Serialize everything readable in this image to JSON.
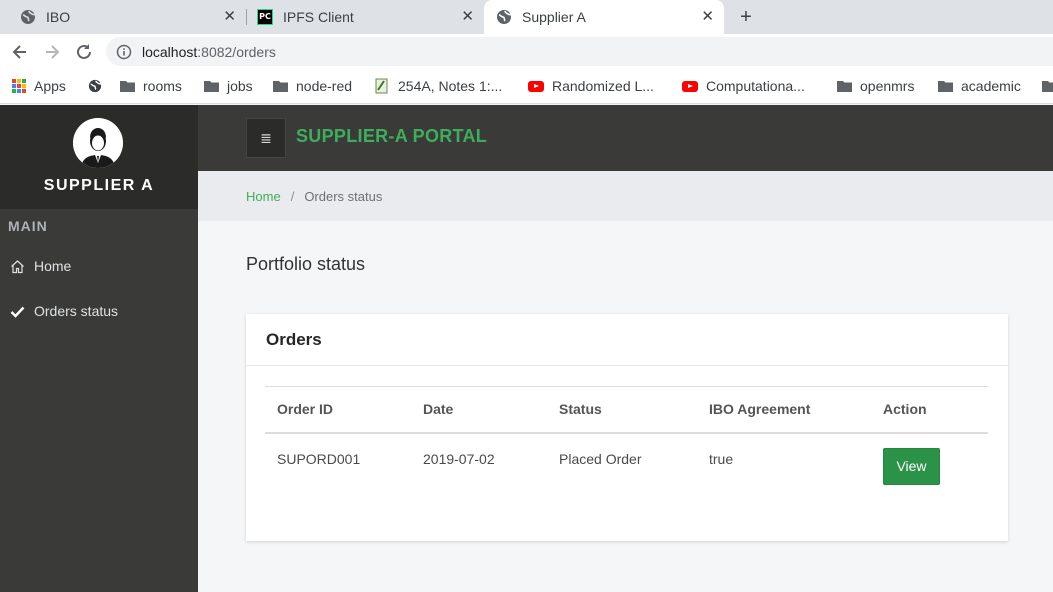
{
  "browser": {
    "tabs": [
      {
        "title": "IBO",
        "icon": "globe-icon",
        "active": false
      },
      {
        "title": "IPFS Client",
        "icon": "pycharm-icon",
        "active": false
      },
      {
        "title": "Supplier A",
        "icon": "globe-icon",
        "active": true
      }
    ],
    "url_host": "localhost",
    "url_rest": ":8082/orders",
    "bookmarks": [
      {
        "label": "Apps",
        "icon": "apps-grid-icon"
      },
      {
        "label": "",
        "icon": "globe-icon"
      },
      {
        "label": "rooms",
        "icon": "folder-icon"
      },
      {
        "label": "jobs",
        "icon": "folder-icon"
      },
      {
        "label": "node-red",
        "icon": "folder-icon"
      },
      {
        "label": "254A, Notes 1:...",
        "icon": "page-icon"
      },
      {
        "label": "Randomized L...",
        "icon": "youtube-icon"
      },
      {
        "label": "Computationa...",
        "icon": "youtube-icon"
      },
      {
        "label": "openmrs",
        "icon": "folder-icon"
      },
      {
        "label": "academic",
        "icon": "folder-icon"
      }
    ]
  },
  "sidebar": {
    "brand": "SUPPLIER A",
    "section": "MAIN",
    "items": [
      {
        "label": "Home",
        "icon": "home-icon"
      },
      {
        "label": "Orders status",
        "icon": "check-icon"
      }
    ]
  },
  "header": {
    "menu_icon": "≣",
    "title": "SUPPLIER-A PORTAL"
  },
  "breadcrumb": {
    "home": "Home",
    "separator": "/",
    "current": "Orders status"
  },
  "main": {
    "heading": "Portfolio status",
    "card_title": "Orders",
    "table": {
      "columns": [
        "Order ID",
        "Date",
        "Status",
        "IBO Agreement",
        "Action"
      ],
      "rows": [
        {
          "order_id": "SUPORD001",
          "date": "2019-07-02",
          "status": "Placed Order",
          "ibo_agreement": "true",
          "action": "View"
        }
      ]
    }
  },
  "colors": {
    "accent_green": "#3fae5c",
    "button_green": "#2b9348",
    "sidebar_dark": "#3a3a38",
    "profile_dark": "#2b2b2a"
  }
}
